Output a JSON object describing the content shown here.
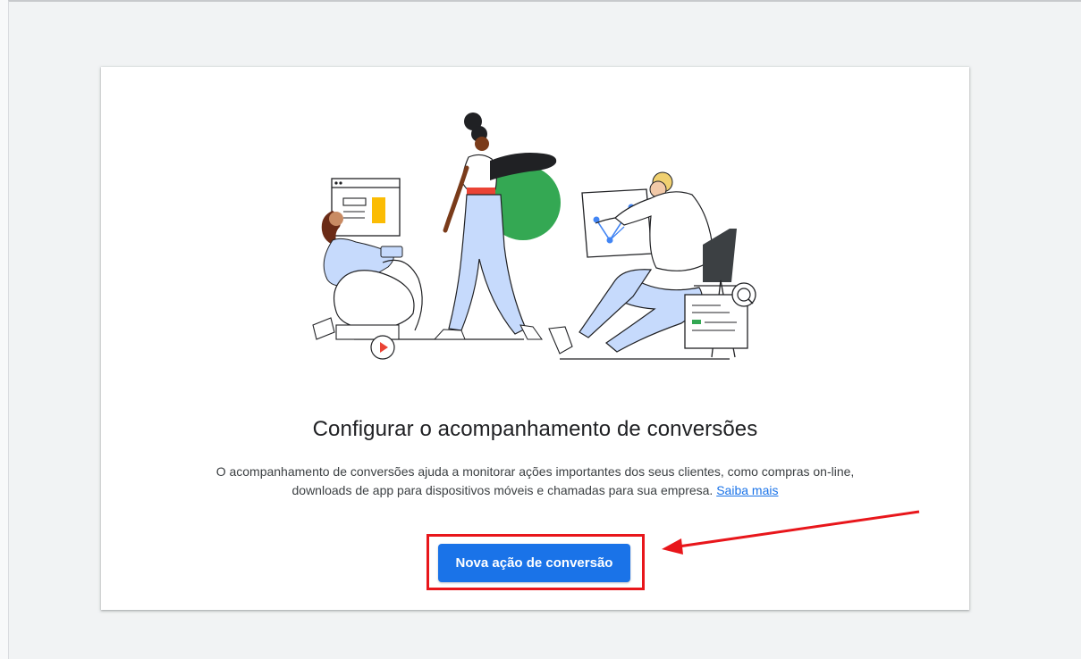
{
  "card": {
    "title": "Configurar o acompanhamento de conversões",
    "description": "O acompanhamento de conversões ajuda a monitorar ações importantes dos seus clientes, como compras on-line, downloads de app para dispositivos móveis e chamadas para sua empresa.",
    "learn_more_link": "Saiba mais",
    "primary_button": "Nova ação de conversão"
  },
  "colors": {
    "accent": "#1a73e8",
    "annotation_red": "#e8161b",
    "illustration_green": "#34a853",
    "illustration_yellow": "#fbbc04",
    "illustration_red": "#ea4335",
    "illustration_lightblue": "#c6dafc"
  }
}
